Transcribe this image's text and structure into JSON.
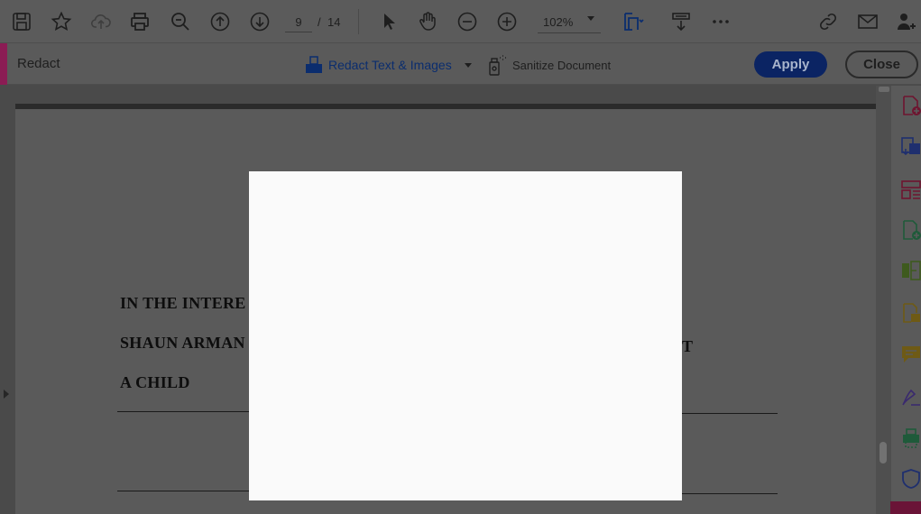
{
  "toolbar": {
    "page_current": "9",
    "page_separator": "/",
    "page_total": "14",
    "zoom_level": "102%",
    "icons": [
      "save-icon",
      "star-icon",
      "upload-cloud-icon",
      "print-icon",
      "zoom-search-icon",
      "page-up-icon",
      "page-down-icon",
      "select-cursor-icon",
      "hand-icon",
      "zoom-out-icon",
      "zoom-in-icon",
      "page-fit-icon",
      "scroll-mode-icon",
      "more-icon",
      "share-link-icon",
      "email-icon",
      "add-user-icon"
    ]
  },
  "redact_bar": {
    "title": "Redact",
    "redact_text_images": "Redact Text & Images",
    "sanitize_document": "Sanitize Document",
    "apply_label": "Apply",
    "close_label": "Close",
    "accent_color": "#8b1c54",
    "apply_color": "#0b2463"
  },
  "document": {
    "line1": "IN THE INTERE",
    "line2": "SHAUN ARMAN",
    "line3": "A CHILD",
    "stray": "T"
  },
  "right_panel": {
    "icons": [
      "create-pdf-icon",
      "export-pdf-icon",
      "organize-pages-icon",
      "edit-pdf-icon",
      "combine-files-icon",
      "compress-pdf-icon",
      "comment-icon",
      "fill-sign-icon",
      "print-production-icon",
      "protect-icon"
    ]
  }
}
